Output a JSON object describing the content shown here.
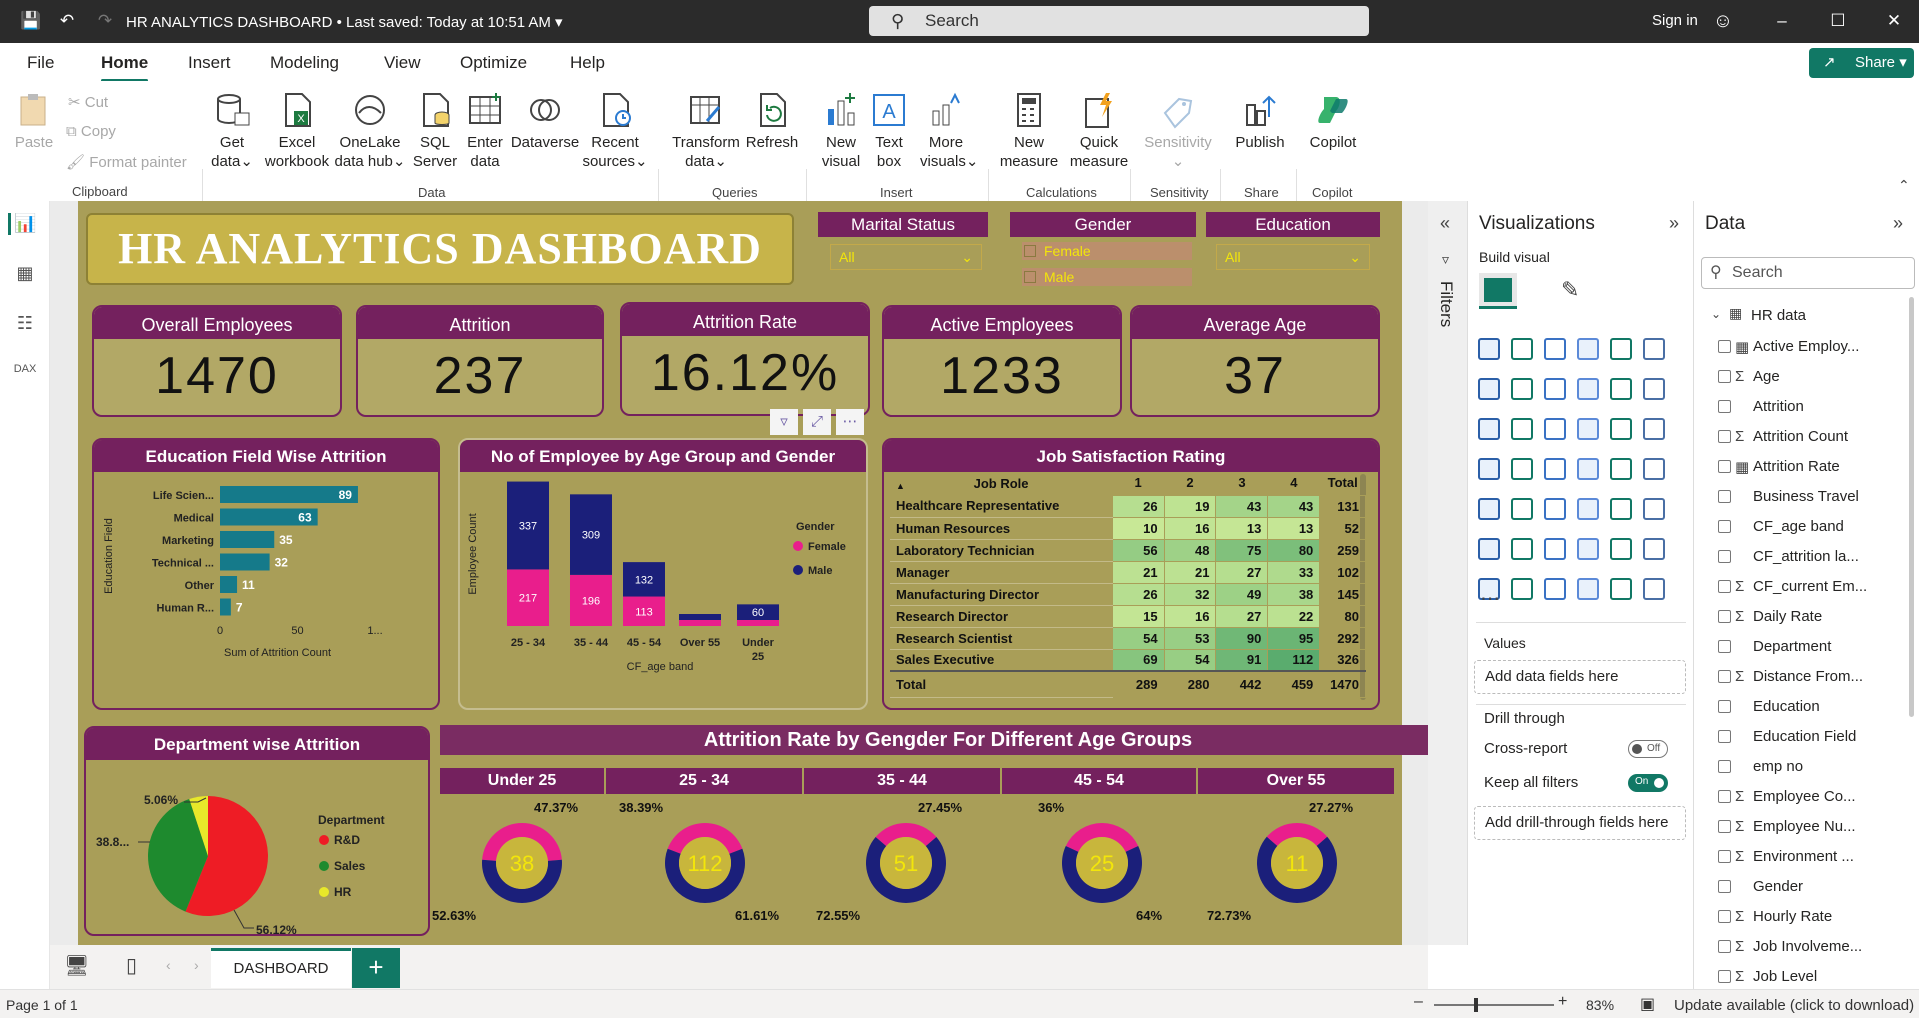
{
  "titlebar": {
    "document_title": "HR ANALYTICS DASHBOARD",
    "saved_status": "Last saved: Today at 10:51 AM",
    "search_placeholder": "Search",
    "sign_in": "Sign in"
  },
  "menu": {
    "file": "File",
    "home": "Home",
    "insert": "Insert",
    "modeling": "Modeling",
    "view": "View",
    "optimize": "Optimize",
    "help": "Help",
    "share": "Share"
  },
  "ribbon": {
    "clipboard": {
      "paste": "Paste",
      "cut": "Cut",
      "copy": "Copy",
      "format_painter": "Format painter",
      "group": "Clipboard"
    },
    "data": {
      "get_data_1": "Get",
      "get_data_2": "data",
      "excel_1": "Excel",
      "excel_2": "workbook",
      "onelake_1": "OneLake",
      "onelake_2": "data hub",
      "sql_1": "SQL",
      "sql_2": "Server",
      "enter_1": "Enter",
      "enter_2": "data",
      "dataverse": "Dataverse",
      "recent_1": "Recent",
      "recent_2": "sources",
      "group": "Data"
    },
    "queries": {
      "transform_1": "Transform",
      "transform_2": "data",
      "refresh": "Refresh",
      "group": "Queries"
    },
    "insert": {
      "new_visual_1": "New",
      "new_visual_2": "visual",
      "text_box_1": "Text",
      "text_box_2": "box",
      "more_visuals_1": "More",
      "more_visuals_2": "visuals",
      "group": "Insert"
    },
    "calculations": {
      "new_measure_1": "New",
      "new_measure_2": "measure",
      "quick_measure_1": "Quick",
      "quick_measure_2": "measure",
      "group": "Calculations"
    },
    "sensitivity": {
      "label": "Sensitivity",
      "group": "Sensitivity"
    },
    "share": {
      "publish": "Publish",
      "group": "Share"
    },
    "copilot": {
      "label": "Copilot",
      "group": "Copilot"
    }
  },
  "dashboard": {
    "title": "HR ANALYTICS DASHBOARD",
    "slicers": {
      "marital": {
        "label": "Marital Status",
        "value": "All"
      },
      "gender": {
        "label": "Gender",
        "options": [
          "Female",
          "Male"
        ]
      },
      "education": {
        "label": "Education",
        "value": "All"
      }
    },
    "kpis": [
      {
        "label": "Overall Employees",
        "value": "1470"
      },
      {
        "label": "Attrition",
        "value": "237"
      },
      {
        "label": "Attrition Rate",
        "value": "16.12%"
      },
      {
        "label": "Active Employees",
        "value": "1233"
      },
      {
        "label": "Average Age",
        "value": "37"
      }
    ],
    "edu_chart": {
      "title": "Education Field Wise Attrition",
      "ylabel": "Education Field",
      "xlabel": "Sum of Attrition Count",
      "ticks": [
        "0",
        "50",
        "1..."
      ],
      "colors": {
        "bar": "#157a8a"
      }
    },
    "age_chart": {
      "title": "No of Employee by Age Group and Gender",
      "ylabel": "Employee Count",
      "xlabel": "CF_age band",
      "legend_title": "Gender",
      "legend": [
        "Female",
        "Male"
      ],
      "colors": {
        "female": "#e91e8c",
        "male": "#1b1f7a"
      }
    },
    "job_table": {
      "title": "Job Satisfaction Rating",
      "headers": [
        "Job Role",
        "1",
        "2",
        "3",
        "4",
        "Total"
      ],
      "rows": [
        [
          "Healthcare Representative",
          "26",
          "19",
          "43",
          "43",
          "131"
        ],
        [
          "Human Resources",
          "10",
          "16",
          "13",
          "13",
          "52"
        ],
        [
          "Laboratory Technician",
          "56",
          "48",
          "75",
          "80",
          "259"
        ],
        [
          "Manager",
          "21",
          "21",
          "27",
          "33",
          "102"
        ],
        [
          "Manufacturing Director",
          "26",
          "32",
          "49",
          "38",
          "145"
        ],
        [
          "Research Director",
          "15",
          "16",
          "27",
          "22",
          "80"
        ],
        [
          "Research Scientist",
          "54",
          "53",
          "90",
          "95",
          "292"
        ],
        [
          "Sales Executive",
          "69",
          "54",
          "91",
          "112",
          "326"
        ]
      ],
      "total": [
        "Total",
        "289",
        "280",
        "442",
        "459",
        "1470"
      ]
    },
    "dept_chart": {
      "title": "Department wise Attrition",
      "legend_title": "Department",
      "legend": [
        "R&D",
        "Sales",
        "HR"
      ],
      "labels": [
        "5.06%",
        "38.8...",
        "56.12%"
      ],
      "colors": {
        "rd": "#ee1c25",
        "sales": "#1e8a2e",
        "hr": "#e8e82a"
      }
    },
    "gender_rate": {
      "title": "Attrition Rate by Gengder For Different Age Groups",
      "groups": [
        {
          "label": "Under 25",
          "center": "38",
          "top": "47.37%",
          "bottom": "52.63%"
        },
        {
          "label": "25 - 34",
          "center": "112",
          "top": "38.39%",
          "bottom": "61.61%"
        },
        {
          "label": "35 - 44",
          "center": "51",
          "top": "27.45%",
          "bottom": "72.55%"
        },
        {
          "label": "45 - 54",
          "center": "25",
          "top": "36%",
          "bottom": "64%"
        },
        {
          "label": "Over 55",
          "center": "11",
          "top": "27.27%",
          "bottom": "72.73%"
        }
      ],
      "colors": {
        "female": "#e91e8c",
        "male": "#1b1f7a",
        "center": "#c8b63c",
        "text": "#f3e60a"
      }
    }
  },
  "chart_data": [
    {
      "type": "bar",
      "title": "Education Field Wise Attrition",
      "categories": [
        "Life Scien...",
        "Medical",
        "Marketing",
        "Technical ...",
        "Other",
        "Human R..."
      ],
      "values": [
        89,
        63,
        35,
        32,
        11,
        7
      ],
      "xlabel": "Sum of Attrition Count",
      "ylabel": "Education Field",
      "xlim": [
        0,
        100
      ]
    },
    {
      "type": "bar",
      "title": "No of Employee by Age Group and Gender",
      "categories": [
        "25 - 34",
        "35 - 44",
        "45 - 54",
        "Over 55",
        "Under 25"
      ],
      "series": [
        {
          "name": "Female",
          "values": [
            217,
            196,
            113,
            0,
            0
          ]
        },
        {
          "name": "Male",
          "values": [
            337,
            309,
            132,
            0,
            60
          ]
        }
      ],
      "xlabel": "CF_age band",
      "ylabel": "Employee Count"
    },
    {
      "type": "pie",
      "title": "Department wise Attrition",
      "categories": [
        "R&D",
        "Sales",
        "HR"
      ],
      "values": [
        56.12,
        38.82,
        5.06
      ]
    }
  ],
  "panes": {
    "filters": "Filters",
    "visualizations": {
      "title": "Visualizations",
      "build": "Build visual",
      "values": "Values",
      "add_fields": "Add data fields here",
      "drill": "Drill through",
      "cross_report": "Cross-report",
      "off": "Off",
      "keep_filters": "Keep all filters",
      "on": "On",
      "add_drill": "Add drill-through fields here"
    },
    "data": {
      "title": "Data",
      "search": "Search",
      "table": "HR data",
      "fields": [
        "Active Employ...",
        "Age",
        "Attrition",
        "Attrition Count",
        "Attrition Rate",
        "Business Travel",
        "CF_age band",
        "CF_attrition la...",
        "CF_current Em...",
        "Daily Rate",
        "Department",
        "Distance From...",
        "Education",
        "Education Field",
        "emp no",
        "Employee Co...",
        "Employee Nu...",
        "Environment ...",
        "Gender",
        "Hourly Rate",
        "Job Involveme...",
        "Job Level"
      ],
      "sigma": [
        false,
        true,
        false,
        true,
        false,
        false,
        false,
        false,
        true,
        true,
        false,
        true,
        false,
        false,
        false,
        true,
        true,
        true,
        false,
        true,
        true,
        true
      ],
      "calc": [
        true,
        false,
        false,
        false,
        true,
        false,
        false,
        false,
        false,
        false,
        false,
        false,
        false,
        false,
        false,
        false,
        false,
        false,
        false,
        false,
        false,
        false
      ]
    }
  },
  "tabs": {
    "page": "DASHBOARD",
    "add": "+"
  },
  "status": {
    "page": "Page 1 of 1",
    "zoom": "83%",
    "update": "Update available (click to download)"
  }
}
